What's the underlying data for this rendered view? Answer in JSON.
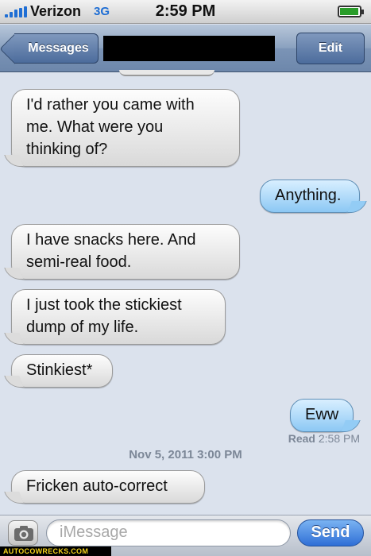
{
  "status_bar": {
    "carrier": "Verizon",
    "network": "3G",
    "time": "2:59 PM",
    "battery_level": 0.95
  },
  "nav": {
    "back_label": "Messages",
    "edit_label": "Edit"
  },
  "messages": [
    {
      "direction": "incoming",
      "text_lines": [
        "I'd rather you came with",
        "me.  What were you",
        "thinking of?"
      ]
    },
    {
      "direction": "outgoing",
      "text_lines": [
        "Anything."
      ]
    },
    {
      "direction": "incoming",
      "text_lines": [
        "I have snacks here. And",
        "semi-real food."
      ]
    },
    {
      "direction": "incoming",
      "text_lines": [
        "I just took the stickiest",
        "dump of my life."
      ]
    },
    {
      "direction": "incoming",
      "text_lines": [
        "Stinkiest*"
      ]
    },
    {
      "direction": "outgoing",
      "text_lines": [
        "Eww"
      ]
    },
    {
      "direction": "incoming",
      "text_lines": [
        "Fricken auto-correct"
      ]
    }
  ],
  "read_receipt": {
    "label": "Read",
    "time": "2:58 PM"
  },
  "timestamp": "Nov 5, 2011 3:00 PM",
  "composer": {
    "placeholder": "iMessage",
    "send_label": "Send",
    "camera_icon": "camera-icon"
  },
  "watermark": "AUTOCOWRECKS.COM",
  "colors": {
    "incoming_bubble": "#ececec",
    "outgoing_bubble": "#a9d7f8",
    "nav_bar": "#7b94b6",
    "send_button": "#2f6fd6",
    "watermark_text": "#f4d31b"
  }
}
